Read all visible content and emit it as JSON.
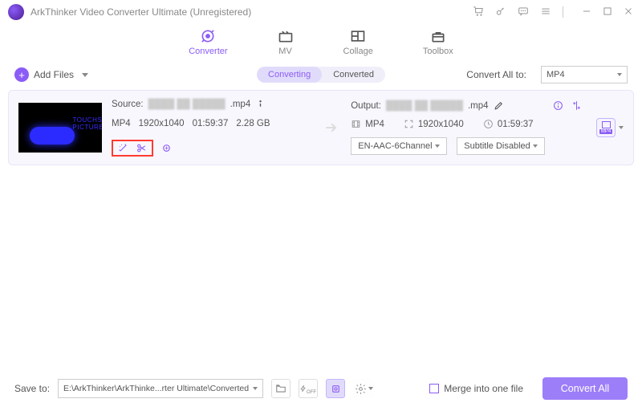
{
  "app": {
    "title": "ArkThinker Video Converter Ultimate (Unregistered)"
  },
  "tabs": {
    "converter": "Converter",
    "mv": "MV",
    "collage": "Collage",
    "toolbox": "Toolbox"
  },
  "toolbar": {
    "add_files": "Add Files",
    "converting": "Converting",
    "converted": "Converted",
    "convert_all_to": "Convert All to:",
    "all_format": "MP4"
  },
  "file": {
    "thumb_text": "TOUCHS\nPICTURES",
    "source_label": "Source:",
    "source_text": ".mp4",
    "output_label": "Output:",
    "output_text": ".mp4",
    "format": "MP4",
    "resolution": "1920x1040",
    "duration": "01:59:37",
    "size": "2.28 GB",
    "out_format": "MP4",
    "out_resolution": "1920x1040",
    "out_duration": "01:59:37",
    "audio": "EN-AAC-6Channel",
    "subtitle": "Subtitle Disabled",
    "profile_label": "MP4"
  },
  "bottom": {
    "save_to": "Save to:",
    "path": "E:\\ArkThinker\\ArkThinke...rter Ultimate\\Converted",
    "merge": "Merge into one file",
    "convert_all": "Convert All"
  }
}
